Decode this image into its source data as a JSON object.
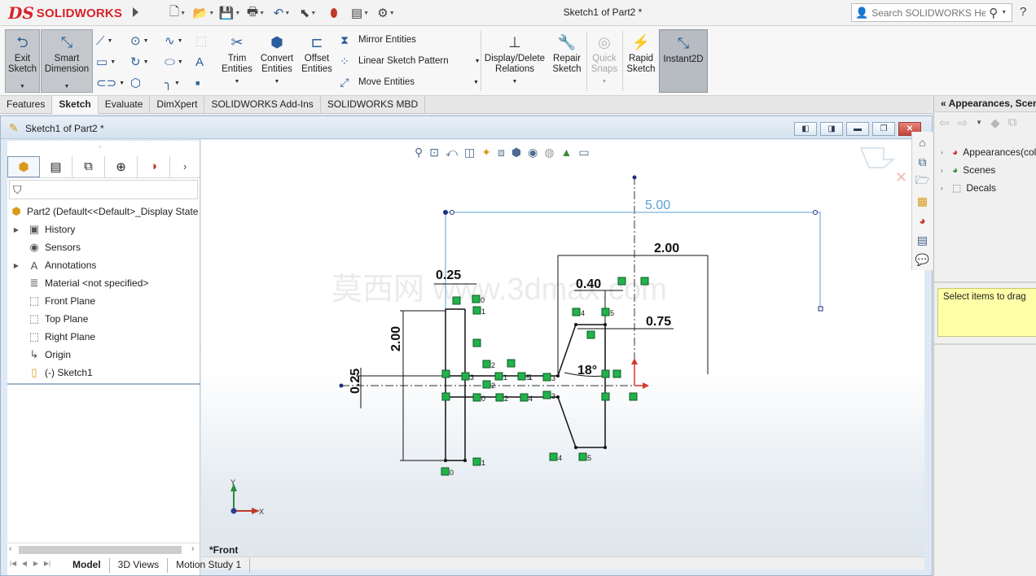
{
  "app": {
    "brand_prefix": "DS",
    "brand_name": "SOLIDWORKS",
    "doc_title": "Sketch1 of Part2 *"
  },
  "search": {
    "placeholder": "Search SOLIDWORKS Help"
  },
  "help": {
    "label": "?"
  },
  "ribbon": {
    "exit_sketch": "Exit Sketch",
    "smart_dimension": "Smart Dimension",
    "trim_entities": "Trim Entities",
    "convert_entities": "Convert Entities",
    "offset_entities": "Offset Entities",
    "mirror_entities": "Mirror Entities",
    "linear_sketch_pattern": "Linear Sketch Pattern",
    "move_entities": "Move Entities",
    "display_delete_relations": "Display/Delete Relations",
    "repair_sketch": "Repair Sketch",
    "quick_snaps": "Quick Snaps",
    "rapid_sketch": "Rapid Sketch",
    "instant2d": "Instant2D"
  },
  "command_tabs": [
    "Features",
    "Sketch",
    "Evaluate",
    "DimXpert",
    "SOLIDWORKS Add-Ins",
    "SOLIDWORKS MBD"
  ],
  "document": {
    "title": "Sketch1 of Part2 *"
  },
  "feature_tree": {
    "root": "Part2  (Default<<Default>_Display State",
    "items": [
      {
        "label": "History",
        "expandable": true,
        "icon": "history-icon"
      },
      {
        "label": "Sensors",
        "expandable": false,
        "icon": "sensors-icon"
      },
      {
        "label": "Annotations",
        "expandable": true,
        "icon": "annotations-icon"
      },
      {
        "label": "Material <not specified>",
        "expandable": false,
        "icon": "material-icon"
      },
      {
        "label": "Front Plane",
        "expandable": false,
        "icon": "plane-icon"
      },
      {
        "label": "Top Plane",
        "expandable": false,
        "icon": "plane-icon"
      },
      {
        "label": "Right Plane",
        "expandable": false,
        "icon": "plane-icon"
      },
      {
        "label": "Origin",
        "expandable": false,
        "icon": "origin-icon"
      },
      {
        "label": "(-) Sketch1",
        "expandable": false,
        "icon": "sketch-icon"
      }
    ]
  },
  "graphics": {
    "view_name": "*Front",
    "watermark": "莫西网 www.3dmax.com",
    "dimensions": {
      "d_500": "5.00",
      "d_200_top": "2.00",
      "d_025_top": "0.25",
      "d_040": "0.40",
      "d_075": "0.75",
      "d_200_left": "2.00",
      "d_025_left": "0.25",
      "d_18deg": "18°"
    },
    "relation_labels": [
      "0",
      "1",
      "1",
      "2",
      "3",
      "1",
      "5",
      "3",
      "2",
      "0",
      "2",
      "4",
      "3",
      "0",
      "1",
      "4",
      "5",
      "4",
      "5"
    ],
    "axis_labels": {
      "x": "X",
      "y": "Y"
    }
  },
  "model_tabs": [
    "Model",
    "3D Views",
    "Motion Study 1"
  ],
  "task_pane": {
    "title": "Appearances, Scenes, and Decals",
    "items": [
      "Appearances(color)",
      "Scenes",
      "Decals"
    ],
    "note": "Select items to drag"
  },
  "colors": {
    "accent": "#2b5d9b",
    "brand": "#d8232a",
    "relation_green": "#22b24c",
    "dim_blue": "#5aa0d8"
  }
}
